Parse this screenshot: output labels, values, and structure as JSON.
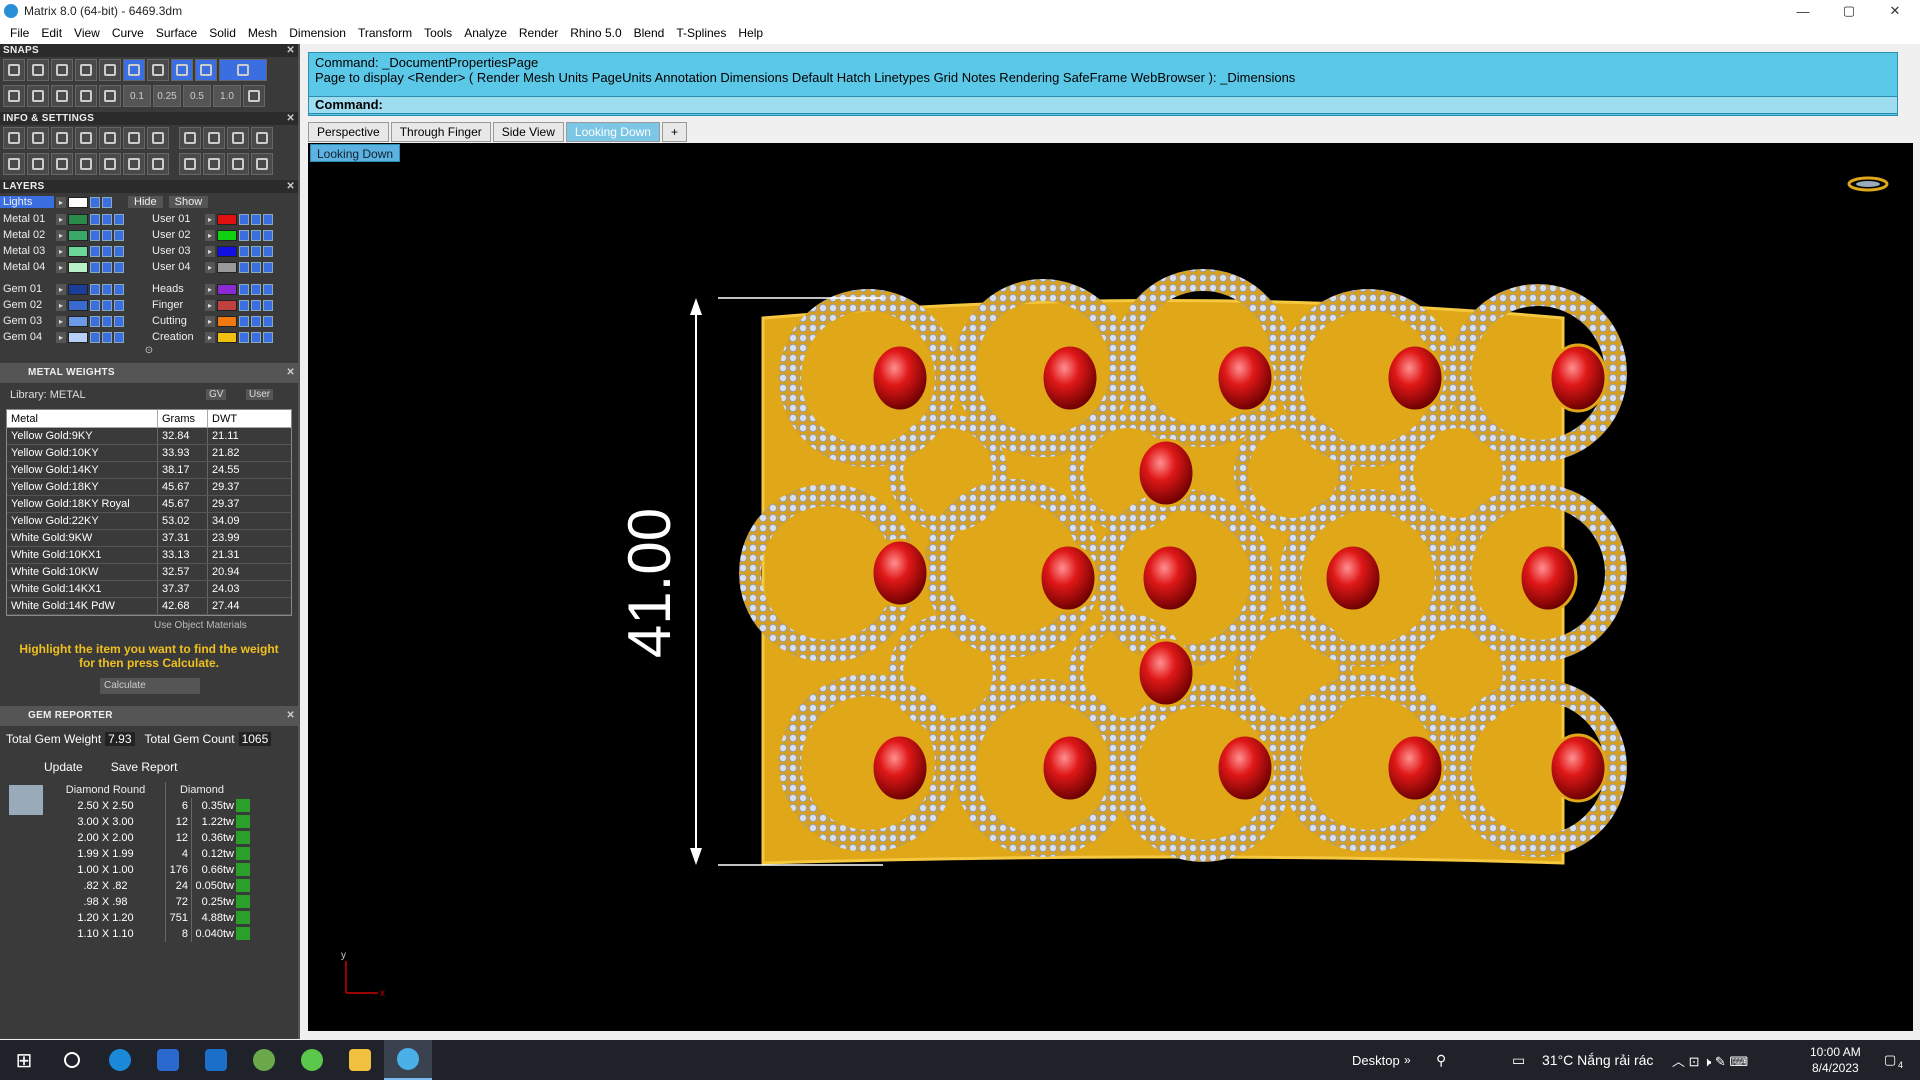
{
  "window": {
    "title": "Matrix 8.0 (64-bit) - 6469.3dm"
  },
  "menu": [
    "File",
    "Edit",
    "View",
    "Curve",
    "Surface",
    "Solid",
    "Mesh",
    "Dimension",
    "Transform",
    "Tools",
    "Analyze",
    "Render",
    "Rhino 5.0",
    "Blend",
    "T-Splines",
    "Help"
  ],
  "panels": {
    "snaps": "SNAPS",
    "info": "INFO & SETTINGS",
    "layers": "LAYERS",
    "metal": "METAL WEIGHTS",
    "gem": "GEM REPORTER"
  },
  "snaps_values": [
    "0.1",
    "0.25",
    "0.5",
    "1.0"
  ],
  "layers": {
    "active": "Lights",
    "hide": "Hide",
    "show": "Show",
    "left": [
      {
        "name": "Metal 01",
        "color": "#2a8a4a"
      },
      {
        "name": "Metal 02",
        "color": "#3aa86a"
      },
      {
        "name": "Metal 03",
        "color": "#6bd89a"
      },
      {
        "name": "Metal 04",
        "color": "#b8f0c8"
      },
      {
        "name": "Gem 01",
        "color": "#1a3d9a"
      },
      {
        "name": "Gem 02",
        "color": "#3a6ad0"
      },
      {
        "name": "Gem 03",
        "color": "#6a9ae8"
      },
      {
        "name": "Gem 04",
        "color": "#b8d0f8"
      }
    ],
    "right": [
      {
        "name": "User 01",
        "color": "#e01010"
      },
      {
        "name": "User 02",
        "color": "#10d010"
      },
      {
        "name": "User 03",
        "color": "#1010e0"
      },
      {
        "name": "User 04",
        "color": "#9a9a9a"
      },
      {
        "name": "Heads",
        "color": "#8a2ad0"
      },
      {
        "name": "Finger",
        "color": "#c04040"
      },
      {
        "name": "Cutting",
        "color": "#f07a10"
      },
      {
        "name": "Creation",
        "color": "#f0c010"
      }
    ]
  },
  "metal": {
    "library": "Library: METAL",
    "gv": "GV",
    "user": "User",
    "headers": [
      "Metal",
      "Grams",
      "DWT"
    ],
    "rows": [
      [
        "Yellow Gold:9KY",
        "32.84",
        "21.11"
      ],
      [
        "Yellow Gold:10KY",
        "33.93",
        "21.82"
      ],
      [
        "Yellow Gold:14KY",
        "38.17",
        "24.55"
      ],
      [
        "Yellow Gold:18KY",
        "45.67",
        "29.37"
      ],
      [
        "Yellow Gold:18KY Royal",
        "45.67",
        "29.37"
      ],
      [
        "Yellow Gold:22KY",
        "53.02",
        "34.09"
      ],
      [
        "White Gold:9KW",
        "37.31",
        "23.99"
      ],
      [
        "White Gold:10KX1",
        "33.13",
        "21.31"
      ],
      [
        "White Gold:10KW",
        "32.57",
        "20.94"
      ],
      [
        "White Gold:14KX1",
        "37.37",
        "24.03"
      ],
      [
        "White Gold:14K PdW",
        "42.68",
        "27.44"
      ]
    ],
    "use_obj": "Use Object Materials",
    "hint": "Highlight the item you want to find the weight for then press Calculate.",
    "calc": "Calculate"
  },
  "gem": {
    "total_weight_label": "Total Gem Weight",
    "total_weight": "7.93",
    "total_count_label": "Total Gem Count",
    "total_count": "1065",
    "update": "Update",
    "save": "Save Report",
    "h1": "Diamond Round",
    "h2": "Diamond",
    "rows": [
      [
        "2.50 X 2.50",
        "6",
        "0.35tw"
      ],
      [
        "3.00 X 3.00",
        "12",
        "1.22tw"
      ],
      [
        "2.00 X 2.00",
        "12",
        "0.36tw"
      ],
      [
        "1.99 X 1.99",
        "4",
        "0.12tw"
      ],
      [
        "1.00 X 1.00",
        "176",
        "0.66tw"
      ],
      [
        ".82 X .82",
        "24",
        "0.050tw"
      ],
      [
        ".98 X .98",
        "72",
        "0.25tw"
      ],
      [
        "1.20 X 1.20",
        "751",
        "4.88tw"
      ],
      [
        "1.10 X 1.10",
        "8",
        "0.040tw"
      ]
    ]
  },
  "command": {
    "line1": "Command: _DocumentPropertiesPage",
    "line2": "Page to display <Render> ( Render  Mesh  Units  PageUnits  Annotation  Dimensions  Default  Hatch  Linetypes  Grid  Notes  Rendering  SafeFrame  WebBrowser ): _Dimensions",
    "prompt": "Command:"
  },
  "tabs": [
    "Perspective",
    "Through Finger",
    "Side View",
    "Looking Down"
  ],
  "viewport": {
    "label": "Looking Down",
    "dimension": "41.00",
    "axis_y": "y",
    "axis_x": "x"
  },
  "taskbar": {
    "desktop": "Desktop",
    "weather": "31°C  Nắng rải rác",
    "time": "10:00 AM",
    "date": "8/4/2023",
    "notif": "4"
  }
}
